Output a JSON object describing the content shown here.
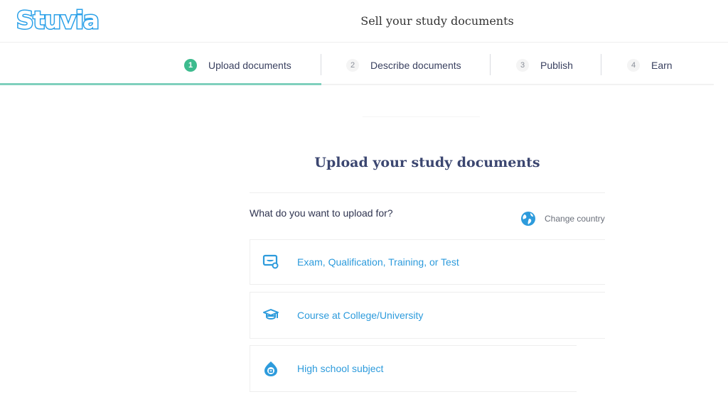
{
  "header": {
    "logo_text": "Stuvia",
    "title": "Sell your study documents"
  },
  "steps": [
    {
      "number": "1",
      "label": "Upload documents",
      "active": true
    },
    {
      "number": "2",
      "label": "Describe documents",
      "active": false
    },
    {
      "number": "3",
      "label": "Publish",
      "active": false
    },
    {
      "number": "4",
      "label": "Earn",
      "active": false
    }
  ],
  "main": {
    "title": "Upload your study documents",
    "question": "What do you want to upload for?",
    "change_country": {
      "label": "Change country",
      "icon": "globe-icon"
    },
    "options": [
      {
        "label": "Exam, Qualification, Training, or Test",
        "icon": "exam-certificate-icon"
      },
      {
        "label": "Course at College/University",
        "icon": "graduation-cap-icon"
      },
      {
        "label": "High school subject",
        "icon": "school-student-icon"
      }
    ]
  },
  "colors": {
    "brand_blue": "#2aa0e8",
    "active_step_green": "#3dbb8e",
    "active_underline": "#7fd0bd",
    "option_text": "#2d9bdc"
  }
}
